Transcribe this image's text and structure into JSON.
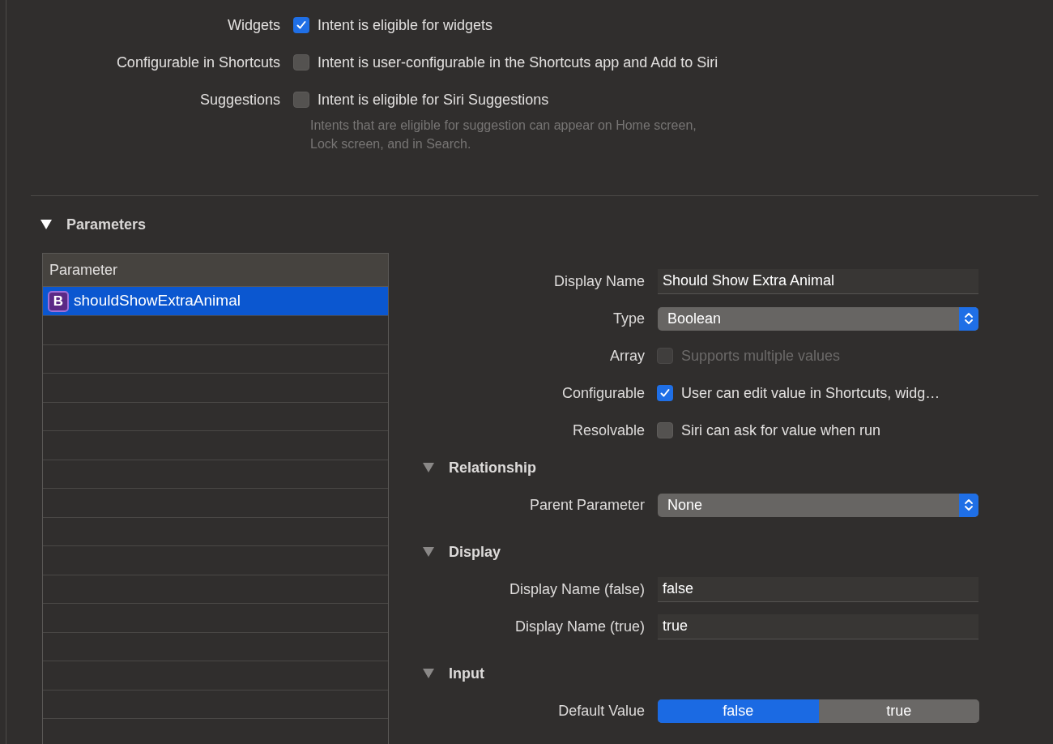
{
  "intent_options": [
    {
      "label": "Widgets",
      "text": "Intent is eligible for widgets",
      "checked": true
    },
    {
      "label": "Configurable in Shortcuts",
      "text": "Intent is user-configurable in the Shortcuts app and Add to Siri",
      "checked": false
    },
    {
      "label": "Suggestions",
      "text": "Intent is eligible for Siri Suggestions",
      "checked": false,
      "hint": [
        "Intents that are eligible for suggestion can appear on Home screen,",
        "Lock screen, and in Search."
      ]
    }
  ],
  "parameters": {
    "title": "Parameters",
    "expanded": true,
    "table": {
      "column": "Parameter",
      "rows": [
        {
          "badge": "B",
          "name": "shouldShowExtraAnimal",
          "selected": true
        }
      ]
    },
    "form": {
      "rows": [
        {
          "kind": "text_field",
          "label": "Display Name",
          "value": "Should Show Extra Animal"
        },
        {
          "kind": "popup",
          "label": "Type",
          "value": "Boolean"
        },
        {
          "kind": "checkbox",
          "label": "Array",
          "text": "Supports multiple values",
          "checked": false,
          "disabled": true
        },
        {
          "kind": "checkbox",
          "label": "Configurable",
          "text": "User can edit value in Shortcuts, widg…",
          "checked": true,
          "disabled": false
        },
        {
          "kind": "checkbox",
          "label": "Resolvable",
          "text": "Siri can ask for value when run",
          "checked": false,
          "disabled": false
        }
      ],
      "sections": [
        {
          "title": "Relationship",
          "expanded": true,
          "rows": [
            {
              "kind": "popup",
              "label": "Parent Parameter",
              "value": "None"
            }
          ]
        },
        {
          "title": "Display",
          "expanded": true,
          "rows": [
            {
              "kind": "text_field",
              "label": "Display Name (false)",
              "value": "false"
            },
            {
              "kind": "text_field",
              "label": "Display Name (true)",
              "value": "true"
            }
          ]
        },
        {
          "title": "Input",
          "expanded": true,
          "rows": [
            {
              "kind": "segmented",
              "label": "Default Value",
              "options": [
                {
                  "label": "false",
                  "selected": true
                },
                {
                  "label": "true",
                  "selected": false
                }
              ]
            }
          ]
        }
      ]
    }
  }
}
